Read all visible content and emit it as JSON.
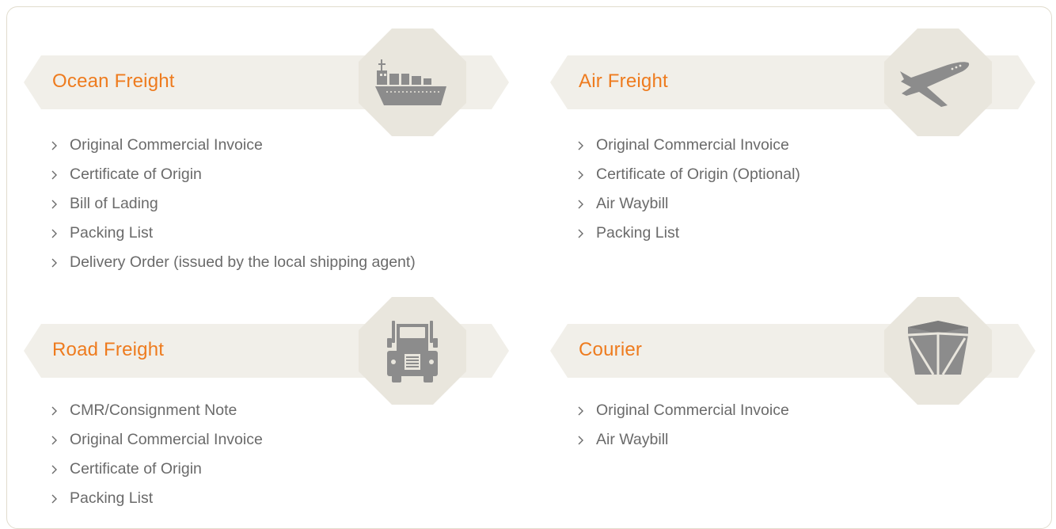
{
  "sections": {
    "ocean": {
      "title": "Ocean Freight",
      "icon": "ship-icon",
      "items": [
        "Original Commercial Invoice",
        "Certificate of Origin",
        "Bill of Lading",
        "Packing List",
        "Delivery Order (issued by the local shipping agent)"
      ]
    },
    "air": {
      "title": "Air Freight",
      "icon": "airplane-icon",
      "items": [
        "Original Commercial Invoice",
        "Certificate of Origin (Optional)",
        "Air Waybill",
        "Packing List"
      ]
    },
    "road": {
      "title": "Road Freight",
      "icon": "truck-icon",
      "items": [
        "CMR/Consignment Note",
        "Original Commercial Invoice",
        "Certificate of Origin",
        "Packing List"
      ]
    },
    "courier": {
      "title": "Courier",
      "icon": "box-icon",
      "items": [
        "Original Commercial Invoice",
        "Air Waybill"
      ]
    }
  },
  "colors": {
    "title": "#ee7b1e",
    "band": "#f1efe9",
    "badge": "#e9e6dd",
    "icon": "#8c8c8c",
    "text": "#6a6a6a",
    "border": "#e1dccd"
  }
}
